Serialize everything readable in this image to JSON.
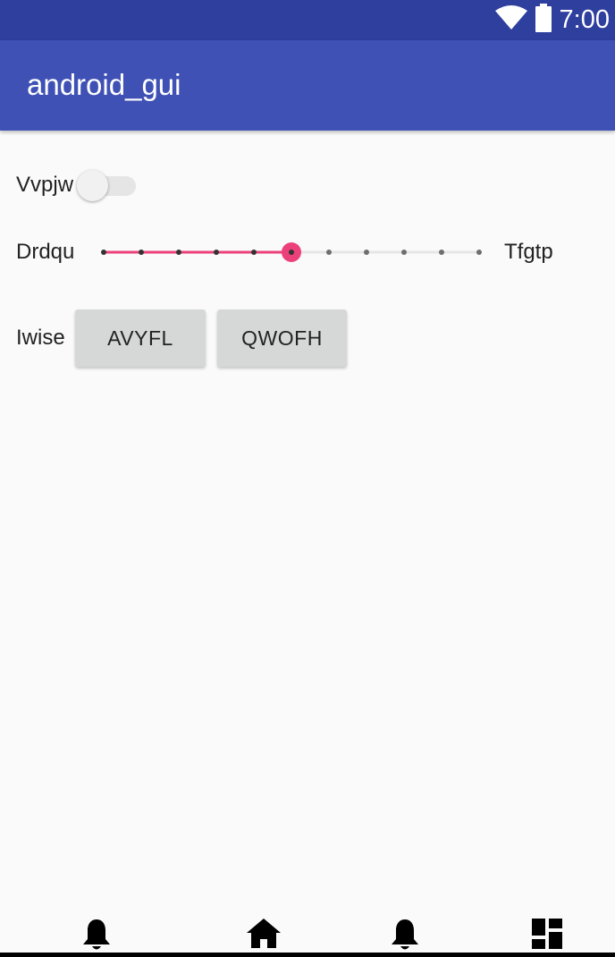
{
  "status_bar": {
    "time": "7:00",
    "icons": [
      "wifi-icon",
      "battery-icon"
    ],
    "color": "#2f3f9e"
  },
  "app_bar": {
    "title": "android_gui",
    "color": "#3f51b5"
  },
  "controls": {
    "switch_row": {
      "label": "Vvpjw",
      "checked": false
    },
    "slider_row": {
      "left_label": "Drdqu",
      "right_label": "Tfgtp",
      "steps": 10,
      "value": 5,
      "accent_color": "#ec407a"
    },
    "button_row": {
      "label": "Iwise",
      "buttons": [
        "AVYFL",
        "QWOFH"
      ]
    }
  },
  "bottom_nav": {
    "items": [
      "bell-icon",
      "home-icon",
      "bell-icon",
      "dashboard-icon"
    ]
  }
}
